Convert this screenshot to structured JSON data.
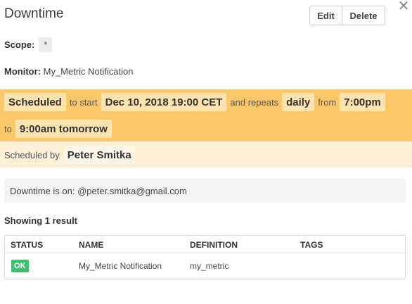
{
  "header": {
    "title": "Downtime",
    "edit_label": "Edit",
    "delete_label": "Delete",
    "close_glyph": "✕"
  },
  "scope": {
    "label": "Scope:",
    "value": "*"
  },
  "monitor": {
    "label": "Monitor:",
    "value": "My_Metric Notification"
  },
  "schedule": {
    "status": "Scheduled",
    "to_start_text": "to start",
    "start": "Dec 10, 2018 19:00 CET",
    "and_repeats_text": "and repeats",
    "frequency": "daily",
    "from_text": "from",
    "from_time": "7:00pm",
    "to_text": "to",
    "to_time": "9:00am tomorrow"
  },
  "scheduled_by": {
    "label": "Scheduled by",
    "name": "Peter Smitka"
  },
  "info": {
    "text": "Downtime is on: @peter.smitka@gmail.com"
  },
  "results": {
    "summary": "Showing 1 result",
    "columns": [
      "STATUS",
      "NAME",
      "DEFINITION",
      "TAGS"
    ],
    "rows": [
      {
        "status": "OK",
        "name": "My_Metric Notification",
        "definition": "my_metric",
        "tags": ""
      }
    ]
  },
  "colors": {
    "schedule_band": "#fbc869",
    "scheduled_by_band": "#fef0d7",
    "ok_badge": "#3fbf6f"
  }
}
